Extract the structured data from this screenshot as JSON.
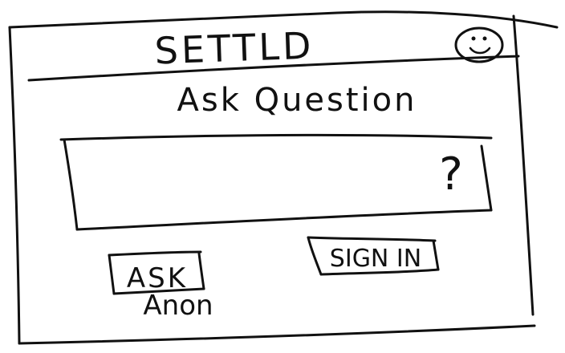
{
  "app": {
    "title": "SETTLD"
  },
  "page": {
    "heading": "Ask Question"
  },
  "question_input": {
    "placeholder": "?"
  },
  "buttons": {
    "sign_in": "SIGN IN",
    "ask_line1": "ASK",
    "ask_line2": "Anon"
  },
  "icons": {
    "profile": "smiley-face-icon"
  }
}
